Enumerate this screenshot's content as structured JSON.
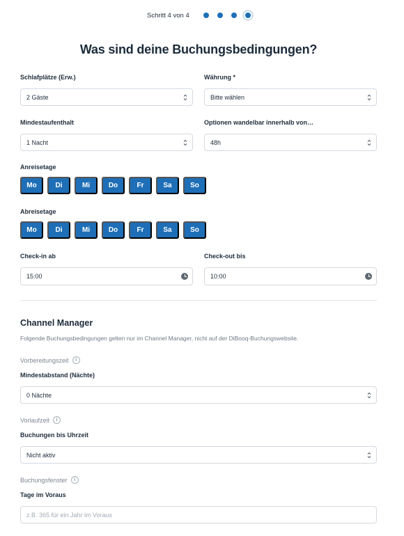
{
  "stepper": {
    "label": "Schritt 4 von 4",
    "total": 4,
    "current": 4
  },
  "title": "Was sind deine Buchungsbedingungen?",
  "fields": {
    "schlafplaetze": {
      "label": "Schlafplätze (Erw.)",
      "value": "2 Gäste"
    },
    "waehrung": {
      "label": "Währung *",
      "value": "Bitte wählen"
    },
    "mindestaufenthalt": {
      "label": "Mindestaufenthalt",
      "value": "1 Nacht"
    },
    "optionen": {
      "label": "Optionen wandelbar innerhalb von…",
      "value": "48h"
    },
    "checkin": {
      "label": "Check-in ab",
      "value": "15:00"
    },
    "checkout": {
      "label": "Check-out bis",
      "value": "10:00"
    }
  },
  "anreise": {
    "label": "Anreisetage",
    "days": [
      "Mo",
      "Di",
      "Mi",
      "Do",
      "Fr",
      "Sa",
      "So"
    ]
  },
  "abreise": {
    "label": "Abreisetage",
    "days": [
      "Mo",
      "Di",
      "Mi",
      "Do",
      "Fr",
      "Sa",
      "So"
    ]
  },
  "channel_manager": {
    "title": "Channel Manager",
    "description": "Folgende Buchungsbedingungen gelten nur im Channel Manager, nicht auf der DiBooq-Buchungswebsite.",
    "vorbereitungszeit": {
      "section": "Vorbereitungszeit",
      "label": "Mindestabstand (Nächte)",
      "value": "0 Nächte"
    },
    "vorlaufzeit": {
      "section": "Vorlaufzeit",
      "label": "Buchungen bis Uhrzeit",
      "value": "Nicht aktiv"
    },
    "buchungsfenster": {
      "section": "Buchungsfenster",
      "label": "Tage im Voraus",
      "placeholder": "z.B. 365 für ein Jahr im Voraus"
    }
  },
  "colors": {
    "accent": "#1e6fb7",
    "border": "#d4d9df",
    "text": "#1f2d3a"
  },
  "icons": {
    "select": "chevron-updown-icon",
    "time": "clock-icon",
    "info": "info-icon"
  }
}
